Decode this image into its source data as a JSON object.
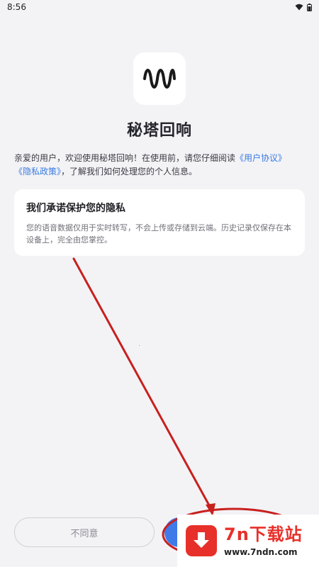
{
  "status_bar": {
    "time": "8:56",
    "icons": [
      "wifi-icon",
      "battery-icon"
    ]
  },
  "app": {
    "icon": "waveform-icon",
    "title": "秘塔回响"
  },
  "intro": {
    "text_before": "亲爱的用户，欢迎使用秘塔回响！在使用前，请您仔细阅读",
    "user_agreement_link": "《用户协议》",
    "privacy_policy_link": "《隐私政策》",
    "text_after": "，了解我们如何处理您的个人信息。",
    "link_color": "#3a7be0"
  },
  "privacy_card": {
    "title": "我们承诺保护您的隐私",
    "body": "您的语音数据仅用于实时转写，不会上传或存储到云端。历史记录仅保存在本设备上，完全由您掌控。"
  },
  "buttons": {
    "disagree_label": "不同意",
    "agree_color": "#3f7be8"
  },
  "watermark": {
    "brand": "7n下载站",
    "url": "www.7ndn.com",
    "color": "#e8302a"
  }
}
